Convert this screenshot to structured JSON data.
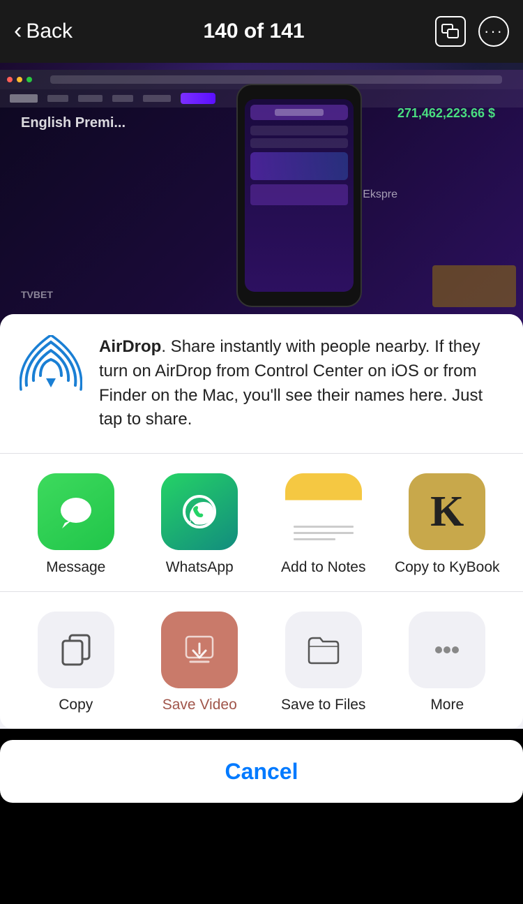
{
  "header": {
    "back_label": "Back",
    "counter": "140 of 141"
  },
  "background": {
    "text_left": "English Premi..."
  },
  "airdrop": {
    "title": "AirDrop",
    "description": ". Share instantly with people nearby. If they turn on AirDrop from Control Center on iOS or from Finder on the Mac, you'll see their names here. Just tap to share."
  },
  "apps": [
    {
      "id": "message",
      "label": "Message"
    },
    {
      "id": "whatsapp",
      "label": "WhatsApp"
    },
    {
      "id": "notes",
      "label": "Add to Notes"
    },
    {
      "id": "kybook",
      "label": "Copy to KyBook"
    }
  ],
  "actions": [
    {
      "id": "copy",
      "label": "Copy"
    },
    {
      "id": "savevideo",
      "label": "Save Video"
    },
    {
      "id": "savetofiles",
      "label": "Save to Files"
    },
    {
      "id": "more",
      "label": "More"
    }
  ],
  "cancel": {
    "label": "Cancel"
  }
}
